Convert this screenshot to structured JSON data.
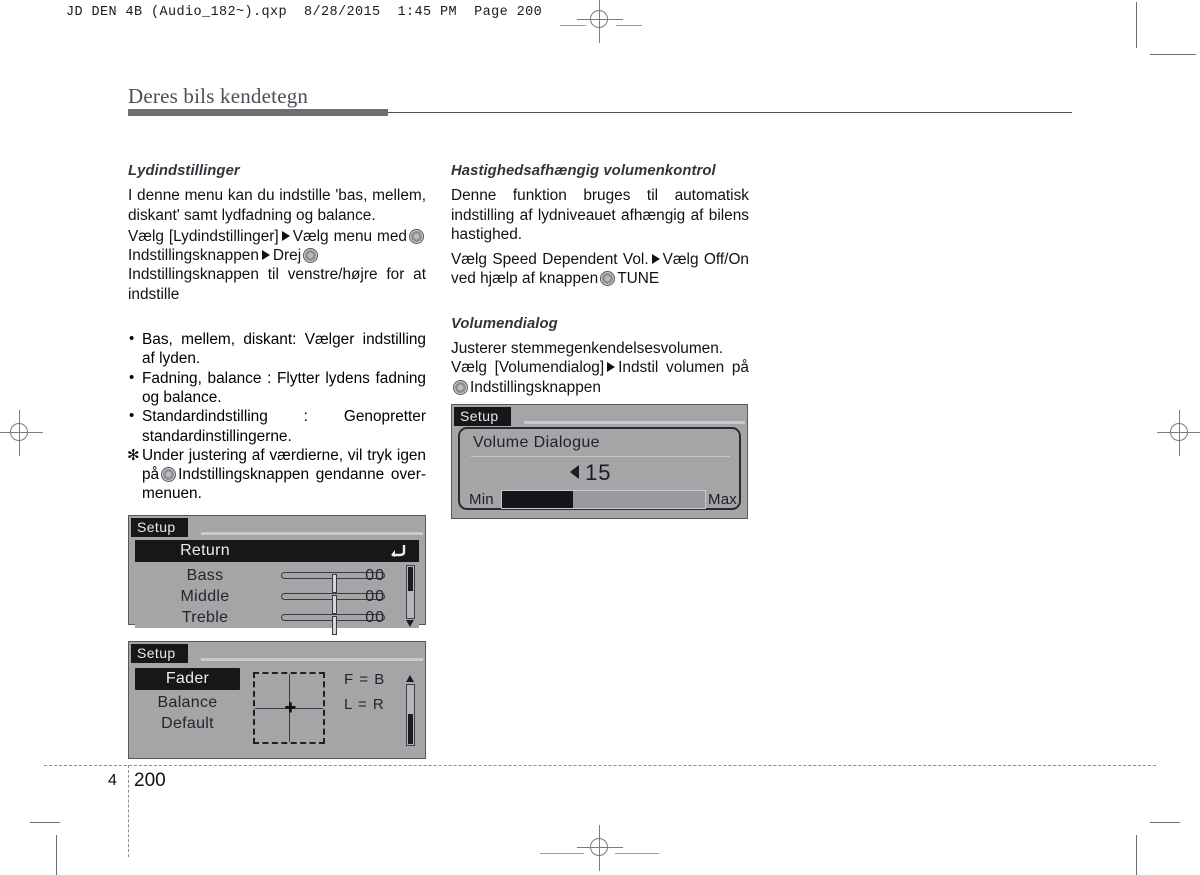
{
  "slug": "JD DEN 4B (Audio_182~).qxp  8/28/2015  1:45 PM  Page 200",
  "chapter_title": "Deres bils kendetegn",
  "left_column": {
    "heading": "Lydindstillinger",
    "intro": "I denne menu kan du indstille 'bas, mellem, diskant' samt lydfadning og balance.",
    "path_1": "Vælg [Lydindstillinger]",
    "path_2": "Vælg menu med",
    "path_3": "Indstillingsknappen",
    "path_4": "Drej",
    "path_5": "Indstillingsknappen til venstre/højre for at indstille",
    "bullets": [
      "Bas, mellem, diskant: Vælger indstilling af lyden.",
      "Fadning, balance : Flytter lydens fadning og balance.",
      "Standardindstilling : Genopretter standardinstillingerne."
    ],
    "note_prefix": "Under justering af værdierne, vil tryk igen på",
    "note_suffix": "Indstillingsknappen gendanne over- menuen.",
    "bullet_marker": "•",
    "note_marker": "✻"
  },
  "right_column": {
    "heading_1": "Hastighedsafhængig volumenkontrol",
    "intro_1": "Denne funktion bruges til automatisk indstilling af lydniveauet afhængig af bilens hastighed.",
    "path_1a": "Vælg Speed Dependent Vol.",
    "path_1b": "Vælg Off/On ved hjælp af knappen",
    "path_1c": "TUNE",
    "heading_2": "Volumendialog",
    "intro_2": "Justerer stemmegenkendelsesvolumen.",
    "path_2a": "Vælg [Volumendialog]",
    "path_2b": "Indstil volumen på",
    "path_2c": "Indstillingsknappen"
  },
  "lcd_eq": {
    "tab": "Setup",
    "rows": [
      {
        "label": "Return",
        "value": "",
        "selected": true,
        "icon": "return-arrow-icon"
      },
      {
        "label": "Bass",
        "value": "00",
        "selected": false,
        "slider": 50
      },
      {
        "label": "Middle",
        "value": "00",
        "selected": false,
        "slider": 50
      },
      {
        "label": "Treble",
        "value": "00",
        "selected": false,
        "slider": 50
      }
    ],
    "scrollbar": {
      "position": "top",
      "arrow": "down"
    }
  },
  "lcd_fader": {
    "tab": "Setup",
    "rows": [
      {
        "label": "Fader",
        "selected": true
      },
      {
        "label": "Balance",
        "selected": false
      },
      {
        "label": "Default",
        "selected": false
      }
    ],
    "readout_1": "F = B",
    "readout_2": "L = R",
    "scrollbar": {
      "position": "bottom",
      "arrow": "up"
    }
  },
  "lcd_volume": {
    "tab": "Setup",
    "title": "Volume Dialogue",
    "value": "15",
    "min_label": "Min",
    "max_label": "Max",
    "fill_percent": 35
  },
  "footer": {
    "chapter_number": "4",
    "page_number": "200"
  },
  "colors": {
    "lcd_background": "#a5a5a8",
    "lcd_selected": "#17171a",
    "title_bar": "#6e6e76",
    "mark": "#7a7a82"
  }
}
